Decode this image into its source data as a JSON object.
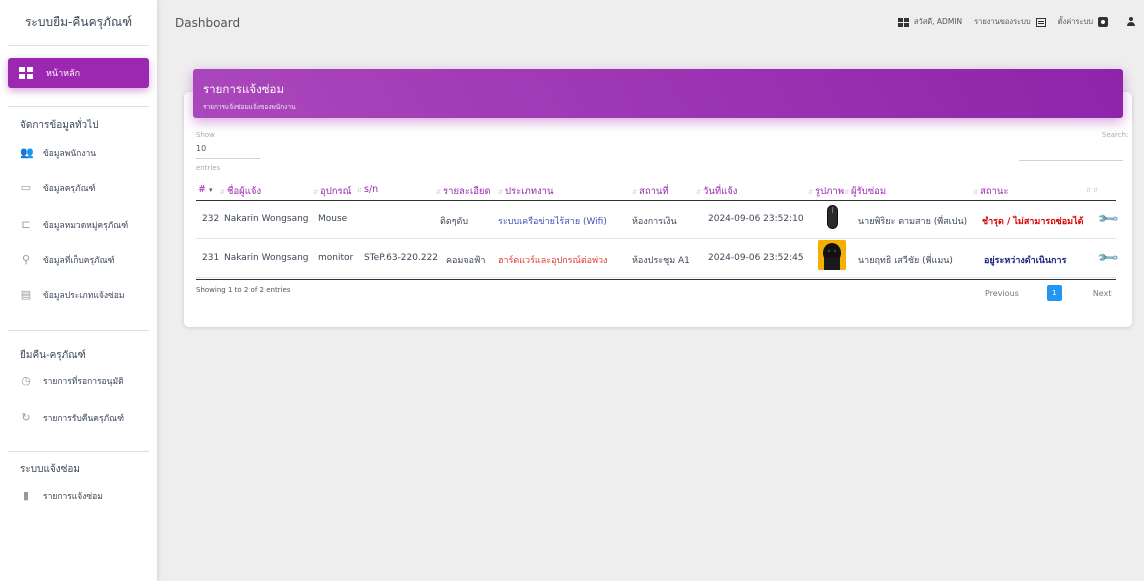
{
  "sidebar": {
    "brand": "ระบบยืม-คืนครุภัณฑ์",
    "active_item": "หน้าหลัก",
    "sections": [
      {
        "title": "จัดการข้อมูลทั่วไป",
        "items": [
          {
            "label": "ข้อมูลพนักงาน",
            "icon": "users-icon"
          },
          {
            "label": "ข้อมูลครุภัณฑ์",
            "icon": "monitor-icon"
          },
          {
            "label": "ข้อมูลหมวดหมู่ครุภัณฑ์",
            "icon": "category-icon"
          },
          {
            "label": "ข้อมูลที่เก็บครุภัณฑ์",
            "icon": "location-icon"
          },
          {
            "label": "ข้อมูลประเภทแจ้งซ่อม",
            "icon": "clipboard-icon"
          }
        ]
      },
      {
        "title": "ยืมคืน-ครุภัณฑ์",
        "items": [
          {
            "label": "รายการที่รอการอนุมัติ",
            "icon": "clock-icon"
          },
          {
            "label": "รายการรับคืนครุภัณฑ์",
            "icon": "refresh-icon"
          }
        ]
      },
      {
        "title": "ระบบแจ้งซ่อม",
        "items": [
          {
            "label": "รายการแจ้งซ่อม",
            "icon": "document-icon"
          }
        ]
      }
    ]
  },
  "topbar": {
    "title": "Dashboard",
    "greeting": "สวัสดี, ADMIN",
    "report": "รายงานของระบบ",
    "settings": "ตั้งค่าระบบ"
  },
  "card": {
    "title": "รายการแจ้งซ่อม",
    "subtitle": "รายการแจ้งซ่อมแจ้งของพนักงาน",
    "show_label": "Show",
    "show_value": "10",
    "entries_label": "entries",
    "search_label": "Search:"
  },
  "table": {
    "headers": {
      "num": "#",
      "reporter": "ชื่อผู้แจ้ง",
      "device": "อุปกรณ์",
      "sn": "s/n",
      "detail": "รายละเอียด",
      "type": "ประเภทงาน",
      "place": "สถานที่",
      "date": "วันที่แจ้ง",
      "image": "รูปภาพ",
      "assignee": "ผู้รับซ่อม",
      "status": "สถานะ"
    },
    "rows": [
      {
        "num": "232",
        "reporter": "Nakarin Wongsang",
        "device": "Mouse",
        "sn": "",
        "detail": "ติดๆดับ",
        "type": "ระบบเครือข่ายไร้สาย (Wifi)",
        "place": "ห้องการเงิน",
        "date": "2024-09-06 23:52:10",
        "assignee": "นายพิริยะ ตามสาย (พี่สเปน)",
        "status": "ชำรุด / ไม่สามารถซ่อมได้"
      },
      {
        "num": "231",
        "reporter": "Nakarin Wongsang",
        "device": "monitor",
        "sn": "STeP.63-220.222",
        "detail": "คอมจอฟ้า",
        "type": "ฮาร์ดแวร์และอุปกรณ์ต่อพ่วง",
        "place": "ห้องประชุม A1",
        "date": "2024-09-06 23:52:45",
        "assignee": "นายฤทธิ เสวีชัย (พี่แมน)",
        "status": "อยู่ระหว่างดำเนินการ"
      }
    ],
    "footer_info": "Showing 1 to 2 of 2 entries"
  },
  "pagination": {
    "previous": "Previous",
    "page": "1",
    "next": "Next"
  },
  "colors": {
    "accent": "#9c27b0",
    "status_red": "#d50000",
    "status_blue": "#1a237e",
    "type_blue": "#3f51b5",
    "type_red": "#e53935",
    "page_active": "#2196f3"
  }
}
